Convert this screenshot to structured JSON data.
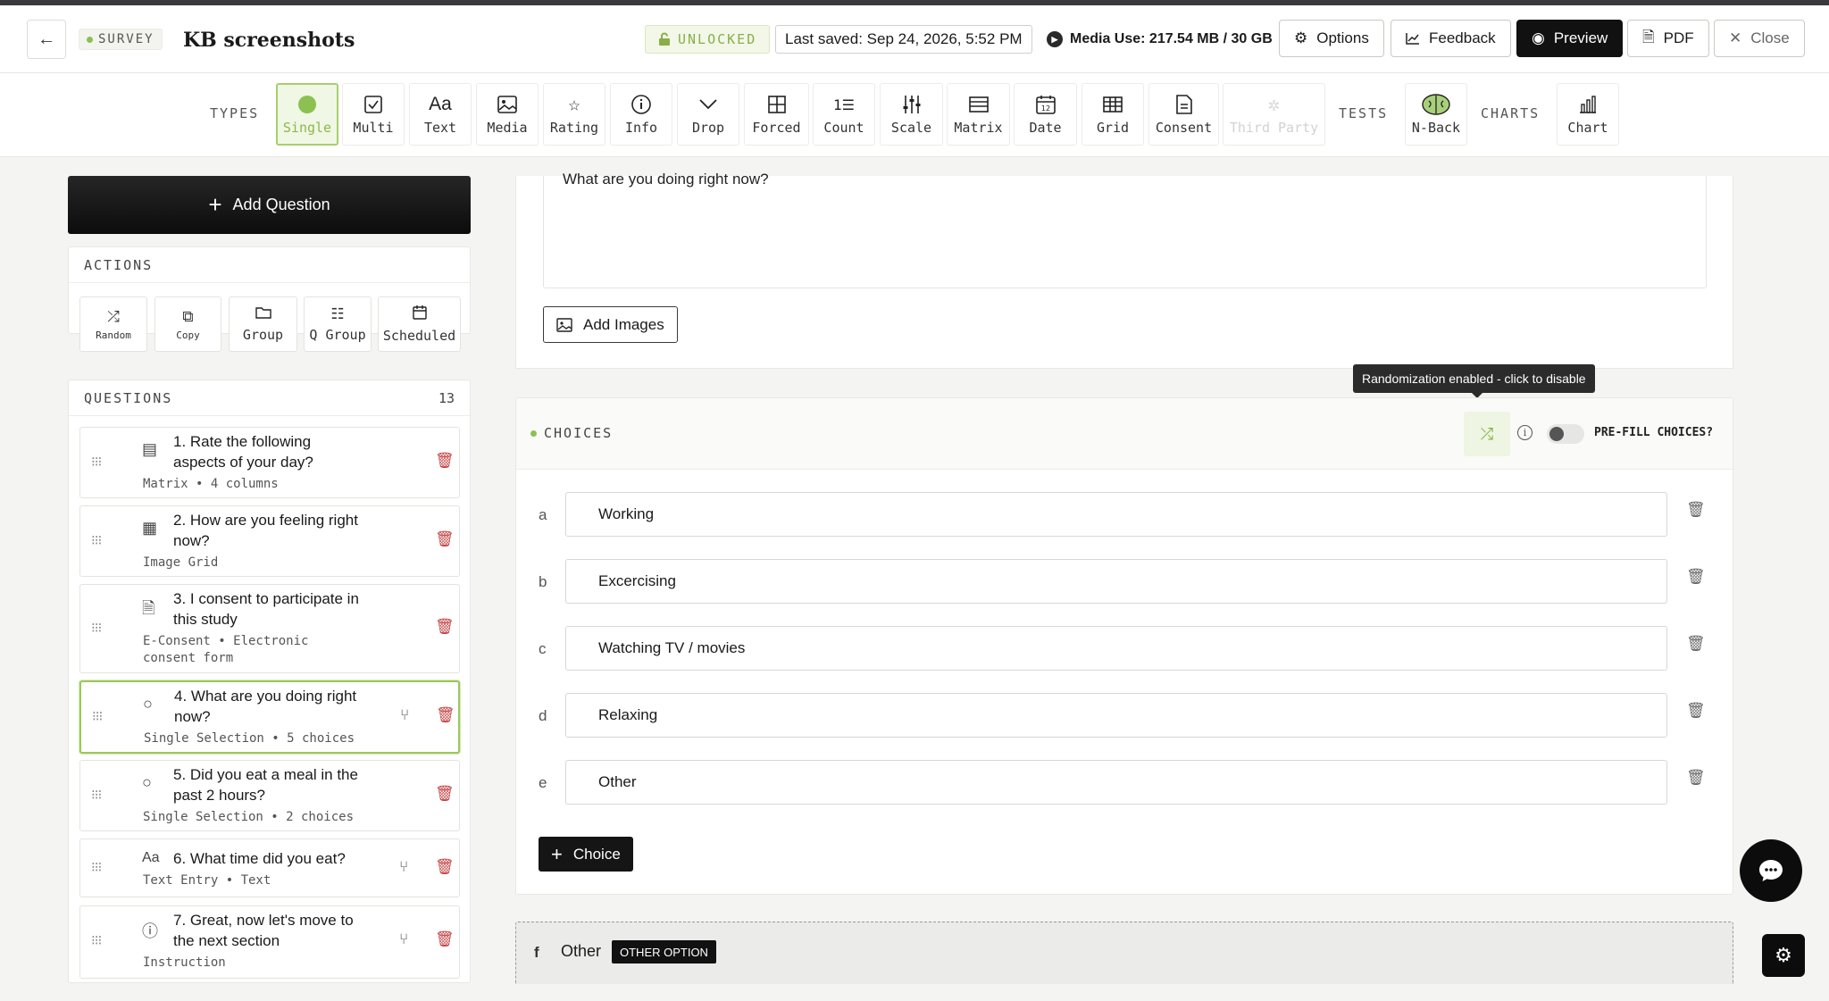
{
  "header": {
    "back_icon": "arrow-left-icon",
    "survey_tag": "SURVEY",
    "title": "KB screenshots",
    "unlocked": "UNLOCKED",
    "last_saved": "Last saved: Sep 24, 2026, 5:52 PM",
    "media_use": "Media Use: 217.54 MB / 30 GB",
    "buttons": {
      "options": "Options",
      "feedback": "Feedback",
      "preview": "Preview",
      "pdf": "PDF",
      "close": "Close"
    }
  },
  "toolbar": {
    "types_label": "TYPES",
    "tests_label": "TESTS",
    "charts_label": "CHARTS",
    "types": [
      {
        "label": "Single",
        "icon": "radio-filled-icon"
      },
      {
        "label": "Multi",
        "icon": "checkbox-icon"
      },
      {
        "label": "Text",
        "icon": "text-aa-icon"
      },
      {
        "label": "Media",
        "icon": "image-icon"
      },
      {
        "label": "Rating",
        "icon": "star-icon"
      },
      {
        "label": "Info",
        "icon": "info-icon"
      },
      {
        "label": "Drop",
        "icon": "chevron-down-icon"
      },
      {
        "label": "Forced",
        "icon": "grid-four-icon"
      },
      {
        "label": "Count",
        "icon": "ordered-list-icon"
      },
      {
        "label": "Scale",
        "icon": "sliders-icon"
      },
      {
        "label": "Matrix",
        "icon": "table-icon"
      },
      {
        "label": "Date",
        "icon": "calendar-icon"
      },
      {
        "label": "Grid",
        "icon": "grid-icon"
      },
      {
        "label": "Consent",
        "icon": "document-icon"
      },
      {
        "label": "Third Party",
        "icon": "plug-icon"
      }
    ],
    "tests": [
      {
        "label": "N-Back",
        "icon": "brain-icon"
      }
    ],
    "charts": [
      {
        "label": "Chart",
        "icon": "bar-chart-icon"
      }
    ]
  },
  "sidebar": {
    "add_question": "Add Question",
    "actions_label": "ACTIONS",
    "actions": [
      {
        "label": "Random",
        "icon": "shuffle-icon"
      },
      {
        "label": "Copy",
        "icon": "copy-icon"
      },
      {
        "label": "Group",
        "icon": "folder-icon"
      },
      {
        "label": "Q Group",
        "icon": "checklist-icon"
      },
      {
        "label": "Scheduled",
        "icon": "calendar-icon"
      }
    ],
    "questions_label": "QUESTIONS",
    "questions_count": "13",
    "questions": [
      {
        "line1": "1. Rate the following",
        "line2": "aspects of your day?",
        "sub1": "Matrix • 4 columns",
        "sub2": "",
        "icon": "table-icon"
      },
      {
        "line1": "2. How are you feeling right",
        "line2": "now?",
        "sub1": "Image Grid",
        "sub2": "",
        "icon": "grid-icon"
      },
      {
        "line1": "3. I consent to participate in",
        "line2": "this study",
        "sub1": "E-Consent • Electronic",
        "sub2": "consent form",
        "icon": "document-icon"
      },
      {
        "line1": "4. What are you doing right",
        "line2": "now?",
        "sub1": "Single Selection • 5 choices",
        "sub2": "",
        "icon": "radio-icon"
      },
      {
        "line1": "5. Did you eat a meal in the",
        "line2": "past 2 hours?",
        "sub1": "Single Selection • 2 choices",
        "sub2": "",
        "icon": "radio-icon"
      },
      {
        "line1": "6. What time did you eat?",
        "line2": "",
        "sub1": "Text Entry • Text",
        "sub2": "",
        "icon": "text-aa-icon"
      },
      {
        "line1": "7. Great, now let's move to",
        "line2": "the next section",
        "sub1": "Instruction",
        "sub2": "",
        "icon": "info-icon"
      }
    ]
  },
  "main": {
    "question_text": "What are you doing right now?",
    "add_images": "Add Images",
    "tooltip": "Randomization enabled - click to disable",
    "choices_label": "CHOICES",
    "prefill_label": "PRE-FILL CHOICES?",
    "choices": [
      {
        "letter": "a",
        "value": "Working"
      },
      {
        "letter": "b",
        "value": "Excercising"
      },
      {
        "letter": "c",
        "value": "Watching TV / movies"
      },
      {
        "letter": "d",
        "value": "Relaxing"
      },
      {
        "letter": "e",
        "value": "Other"
      }
    ],
    "add_choice": "Choice",
    "other": {
      "letter": "f",
      "text": "Other",
      "badge": "OTHER OPTION"
    }
  },
  "colors": {
    "accent_green": "#8cc152",
    "danger": "#c44040",
    "dark": "#111111"
  }
}
